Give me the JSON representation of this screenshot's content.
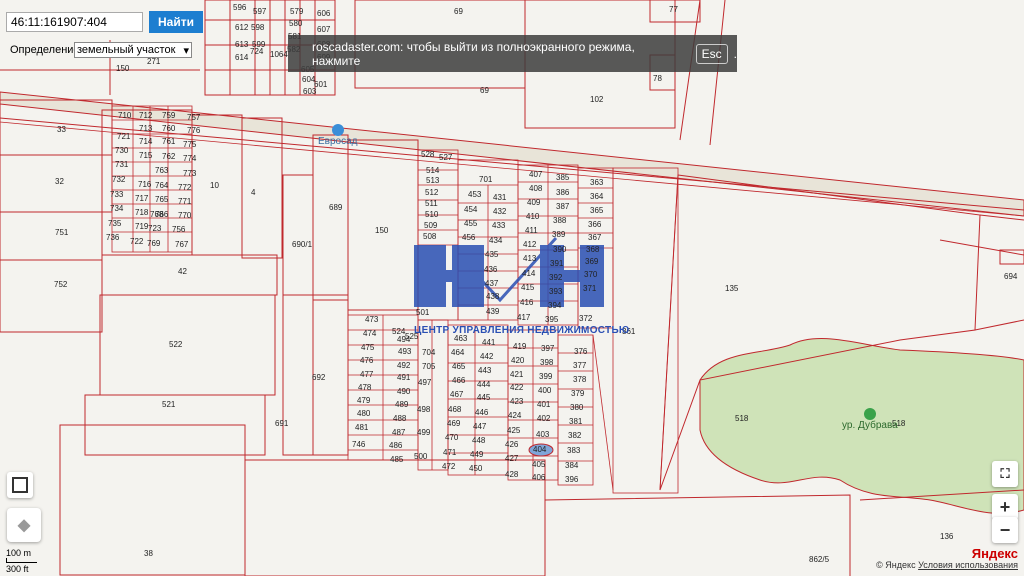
{
  "search": {
    "value": "46:11:161907:404",
    "button": "Найти"
  },
  "definition": {
    "label": "Определение:",
    "selected": "земельный участок"
  },
  "fullscreen_notice": {
    "text": "roscadaster.com: чтобы выйти из полноэкранного режима, нажмите",
    "key": "Esc",
    "suffix": "."
  },
  "poi": {
    "evrosad": "Евросад",
    "dubrava": "ур. Дубрава"
  },
  "watermark": {
    "caption": "ЦЕНТР УПРАВЛЕНИЯ НЕДВИЖИМОСТЬЮ"
  },
  "zoom": {
    "in": "+",
    "out": "−"
  },
  "scale": {
    "metric": "100 m",
    "imperial": "300 ft"
  },
  "attribution": {
    "copyright": "© Яндекс",
    "terms": "Условия использования",
    "logo": "Яндекс"
  },
  "colors": {
    "parcel_line": "#c0282d",
    "forest": "#cfe3b8",
    "road": "#e8e4d8",
    "button": "#1d7ed0",
    "highlight": "#7fa5d8"
  },
  "parcel_labels": [
    "69",
    "77",
    "102",
    "78",
    "69",
    "33",
    "32",
    "751",
    "752",
    "10",
    "4",
    "42",
    "689",
    "150",
    "690/1",
    "692",
    "691",
    "522",
    "521",
    "38",
    "701",
    "135",
    "694",
    "361",
    "518",
    "518",
    "136",
    "862/5",
    "710",
    "712",
    "759",
    "757",
    "721",
    "713",
    "760",
    "776",
    "730",
    "714",
    "761",
    "775",
    "731",
    "715",
    "762",
    "774",
    "732",
    "716",
    "763",
    "773",
    "733",
    "717",
    "764",
    "772",
    "734",
    "718",
    "765",
    "771",
    "735",
    "719",
    "766",
    "770",
    "736",
    "722",
    "769",
    "767",
    "723",
    "768",
    "756",
    "528",
    "527",
    "514",
    "513",
    "512",
    "511",
    "510",
    "509",
    "508",
    "501",
    "453",
    "454",
    "455",
    "456",
    "431",
    "432",
    "433",
    "434",
    "435",
    "436",
    "437",
    "438",
    "439",
    "407",
    "408",
    "409",
    "410",
    "411",
    "412",
    "413",
    "414",
    "415",
    "416",
    "417",
    "385",
    "386",
    "387",
    "388",
    "389",
    "390",
    "391",
    "392",
    "393",
    "394",
    "395",
    "363",
    "364",
    "365",
    "366",
    "367",
    "368",
    "369",
    "370",
    "371",
    "372",
    "473",
    "474",
    "475",
    "476",
    "477",
    "478",
    "479",
    "480",
    "481",
    "746",
    "485",
    "486",
    "487",
    "488",
    "489",
    "490",
    "491",
    "492",
    "493",
    "494",
    "704",
    "705",
    "497",
    "498",
    "499",
    "500",
    "524",
    "525",
    "463",
    "464",
    "465",
    "466",
    "467",
    "468",
    "469",
    "470",
    "471",
    "472",
    "441",
    "442",
    "443",
    "444",
    "445",
    "446",
    "447",
    "448",
    "449",
    "450",
    "419",
    "420",
    "421",
    "422",
    "423",
    "424",
    "425",
    "426",
    "427",
    "428",
    "397",
    "398",
    "399",
    "400",
    "401",
    "402",
    "403",
    "404",
    "405",
    "406",
    "376",
    "377",
    "378",
    "379",
    "380",
    "381",
    "382",
    "383",
    "384",
    "396",
    "724",
    "271",
    "150",
    "612",
    "613",
    "614",
    "596",
    "597",
    "598",
    "599",
    "579",
    "580",
    "581",
    "582",
    "606",
    "607",
    "608",
    "609",
    "605",
    "604",
    "601",
    "603",
    "1064"
  ]
}
